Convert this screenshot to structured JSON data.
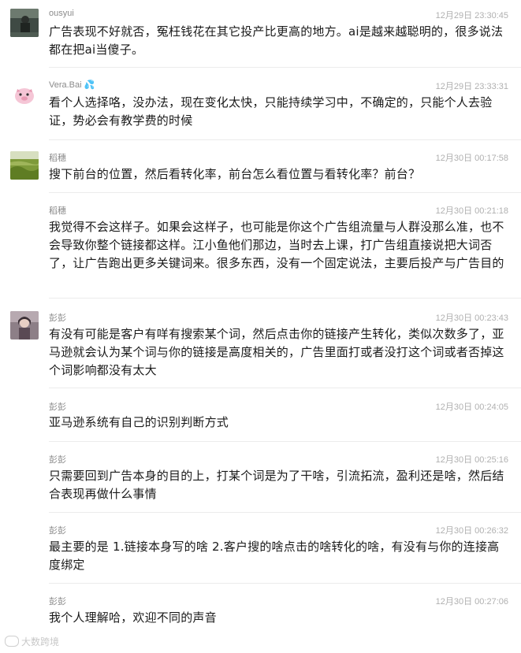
{
  "messages": [
    {
      "name": "ousyui",
      "time": "12月29日 23:30:45",
      "text": "广告表现不好就否，冤枉钱花在其它投产比更高的地方。ai是越来越聪明的，很多说法都在把ai当傻子。",
      "avatar": "photo"
    },
    {
      "name": "Vera.Bai",
      "name_suffix": "💦",
      "time": "12月29日 23:33:31",
      "text": "看个人选择咯，没办法，现在变化太快，只能持续学习中，不确定的，只能个人去验证，势必会有教学费的时候",
      "avatar": "pig"
    },
    {
      "name": "稻穗",
      "time": "12月30日 00:17:58",
      "text": "搜下前台的位置，然后看转化率，前台怎么看位置与看转化率？前台？",
      "avatar": "field"
    },
    {
      "name": "稻穗",
      "time": "12月30日 00:21:18",
      "text": "我觉得不会这样子。如果会这样子，也可能是你这个广告组流量与人群没那么准，也不会导致你整个链接都这样。江小鱼他们那边，当时去上课，打广告组直接说把大词否了，让广告跑出更多关键词来。很多东西，没有一个固定说法，主要后投产与广告目的",
      "avatar": ""
    },
    {
      "name": "彭彭",
      "time": "12月30日 00:23:43",
      "text": "有没有可能是客户有咩有搜索某个词，然后点击你的链接产生转化，类似次数多了，亚马逊就会认为某个词与你的链接是高度相关的，广告里面打或者没打这个词或者否掉这个词影响都没有太大",
      "avatar": "portrait"
    },
    {
      "name": "彭彭",
      "time": "12月30日 00:24:05",
      "text": "亚马逊系统有自己的识别判断方式",
      "avatar": ""
    },
    {
      "name": "彭彭",
      "time": "12月30日 00:25:16",
      "text": "只需要回到广告本身的目的上，打某个词是为了干啥，引流拓流，盈利还是啥，然后结合表现再做什么事情",
      "avatar": ""
    },
    {
      "name": "彭彭",
      "time": "12月30日 00:26:32",
      "text": "最主要的是 1.链接本身写的啥 2.客户搜的啥点击的啥转化的啥，有没有与你的连接高度绑定",
      "avatar": ""
    },
    {
      "name": "彭彭",
      "time": "12月30日 00:27:06",
      "text": "我个人理解哈，欢迎不同的声音",
      "avatar": ""
    }
  ],
  "watermark": "大数跨境"
}
